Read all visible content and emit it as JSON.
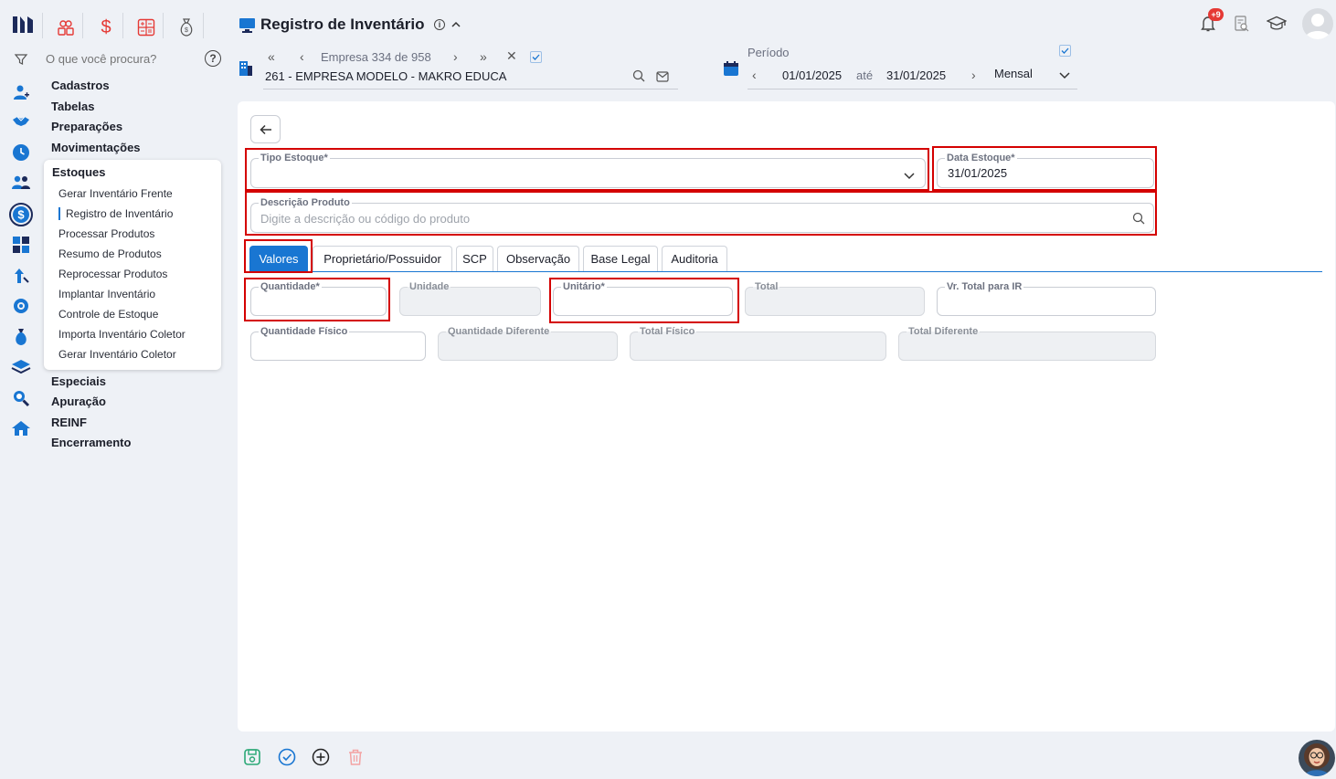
{
  "header": {
    "title": "Registro de Inventário",
    "company_nav": "Empresa 334 de 958",
    "company_name": "261 - EMPRESA MODELO - MAKRO EDUCA",
    "period_label": "Período",
    "date_from": "01/01/2025",
    "date_sep": "até",
    "date_to": "31/01/2025",
    "period_type": "Mensal",
    "notifications_badge": "+9"
  },
  "search": {
    "placeholder": "O que você procura?"
  },
  "menu": {
    "items_top": [
      "Cadastros",
      "Tabelas",
      "Preparações",
      "Movimentações"
    ],
    "submenu_title": "Estoques",
    "submenu": [
      "Gerar Inventário Frente",
      "Registro de Inventário",
      "Processar Produtos",
      "Resumo de Produtos",
      "Reprocessar Produtos",
      "Implantar Inventário",
      "Controle de Estoque",
      "Importa Inventário Coletor",
      "Gerar Inventário Coletor"
    ],
    "items_bottom": [
      "Especiais",
      "Apuração",
      "REINF",
      "Encerramento"
    ]
  },
  "form": {
    "tipo_estoque_label": "Tipo Estoque*",
    "data_estoque_label": "Data Estoque*",
    "data_estoque_value": "31/01/2025",
    "descricao_label": "Descrição Produto",
    "descricao_placeholder": "Digite a descrição ou código do produto",
    "quantidade_label": "Quantidade*",
    "unidade_label": "Unidade",
    "unitario_label": "Unitário*",
    "total_label": "Total",
    "vr_total_ir_label": "Vr. Total para IR",
    "quantidade_fisico_label": "Quantidade Físico",
    "quantidade_diferente_label": "Quantidade Diferente",
    "total_fisico_label": "Total Físico",
    "total_diferente_label": "Total Diferente"
  },
  "tabs": [
    "Valores",
    "Proprietário/Possuidor",
    "SCP",
    "Observação",
    "Base Legal",
    "Auditoria"
  ],
  "colors": {
    "accent": "#1976d2",
    "highlight": "#d40000",
    "save": "#2aa876",
    "delete": "#f3a3a3"
  }
}
